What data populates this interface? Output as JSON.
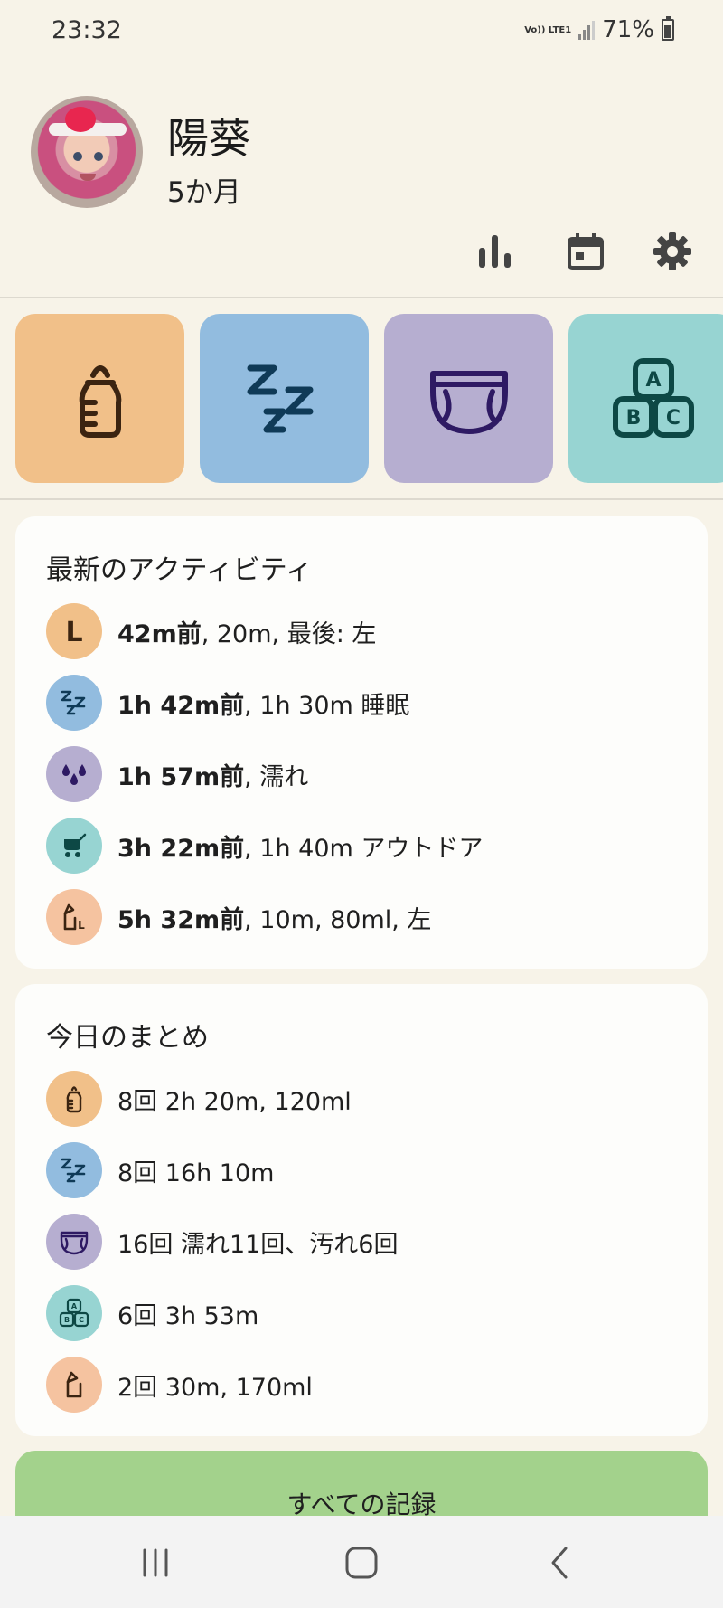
{
  "status_bar": {
    "time": "23:32",
    "network": "Vo)) LTE1",
    "battery": "71%"
  },
  "profile": {
    "name": "陽葵",
    "age": "5か月"
  },
  "header_actions": [
    "stats-icon",
    "calendar-icon",
    "settings-icon"
  ],
  "quick_tiles": [
    {
      "icon": "bottle-icon",
      "color": "#f1c089"
    },
    {
      "icon": "sleep-icon",
      "color": "#92bcdf"
    },
    {
      "icon": "diaper-icon",
      "color": "#b6aed0"
    },
    {
      "icon": "abc-blocks-icon",
      "color": "#97d4d2"
    }
  ],
  "recent_activity": {
    "title": "最新のアクティビティ",
    "items": [
      {
        "icon": "breast-left-icon",
        "color": "#f1c089",
        "bold": "42m前",
        "text": ", 20m, 最後: 左"
      },
      {
        "icon": "sleep-icon",
        "color": "#92bcdf",
        "bold": "1h 42m前",
        "text": ", 1h 30m 睡眠"
      },
      {
        "icon": "wet-drops-icon",
        "color": "#b6aed0",
        "bold": "1h 57m前",
        "text": ", 濡れ"
      },
      {
        "icon": "stroller-icon",
        "color": "#97d4d2",
        "bold": "3h 22m前",
        "text": ", 1h 40m アウトドア"
      },
      {
        "icon": "pump-left-icon",
        "color": "#f5c3a0",
        "bold": "5h 32m前",
        "text": ", 10m, 80ml, 左"
      }
    ]
  },
  "today_summary": {
    "title": "今日のまとめ",
    "items": [
      {
        "icon": "bottle-icon",
        "color": "#f1c089",
        "text": "8回 2h 20m, 120ml"
      },
      {
        "icon": "sleep-icon",
        "color": "#92bcdf",
        "text": "8回 16h 10m"
      },
      {
        "icon": "diaper-icon",
        "color": "#b6aed0",
        "text": "16回 濡れ11回、汚れ6回"
      },
      {
        "icon": "abc-blocks-icon",
        "color": "#97d4d2",
        "text": "6回 3h 53m"
      },
      {
        "icon": "pump-icon",
        "color": "#f5c3a0",
        "text": "2回 30m, 170ml"
      }
    ]
  },
  "all_records_label": "すべての記録",
  "colors": {
    "background": "#f7f3e8",
    "card": "#fdfdfb",
    "button": "#a3d28c",
    "icon_dark": "#3b2411",
    "sleep_dark": "#0f3a57",
    "diaper_dark": "#2e1a63",
    "blocks_dark": "#0d4845"
  }
}
